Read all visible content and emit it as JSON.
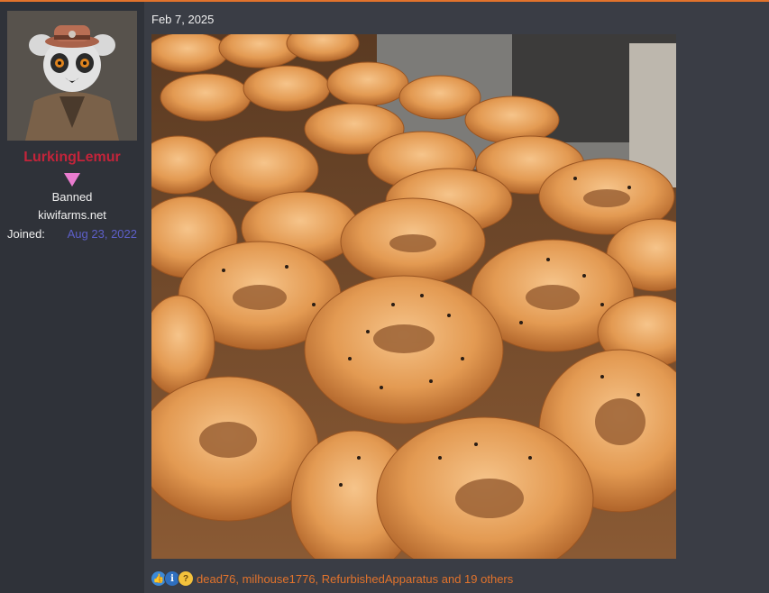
{
  "post": {
    "date": "Feb 7, 2025"
  },
  "user": {
    "username": "LurkingLemur",
    "title": "Banned",
    "banner": "kiwifarms.net",
    "joined_label": "Joined:",
    "joined_value": "Aug 23, 2022"
  },
  "reactions": {
    "icons": [
      "like-icon",
      "informative-icon",
      "thinking-icon"
    ],
    "text": "dead76, milhouse1776, RefurbishedApparatus and 19 others"
  },
  "colors": {
    "accent": "#e2732c",
    "username": "#c4243a",
    "joined_value": "#5d5fc9",
    "background": "#3a3d45",
    "sidebar": "#2f3239"
  }
}
